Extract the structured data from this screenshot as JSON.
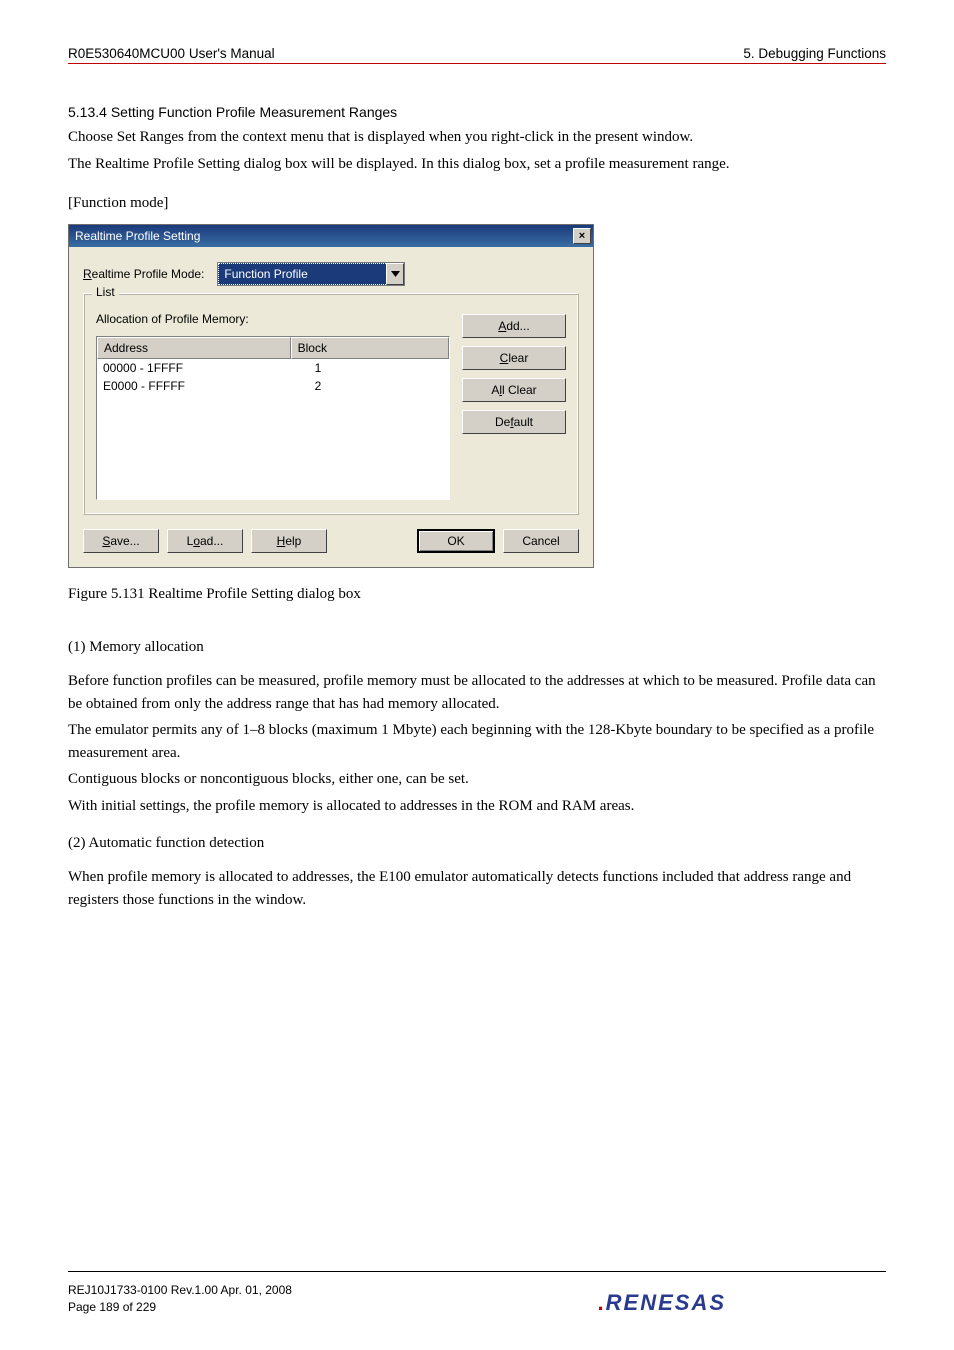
{
  "header": {
    "left": "R0E530640MCU00 User's Manual",
    "right": "5. Debugging Functions"
  },
  "section": {
    "heading": "5.13.4   Setting Function Profile Measurement Ranges",
    "intro1": "Choose Set Ranges from the context menu that is displayed when you right-click in the present window.",
    "intro2": "The Realtime Profile Setting dialog box will be displayed. In this dialog box, set a profile measurement range.",
    "mode_label": "[Function mode]"
  },
  "dialog": {
    "title": "Realtime Profile Setting",
    "close_glyph": "×",
    "mode_label_u": "R",
    "mode_label_rest": "ealtime Profile Mode:",
    "mode_value": "Function Profile",
    "list_legend": "List",
    "alloc_label": "Allocation of Profile Memory:",
    "table": {
      "headers": [
        "Address",
        "Block"
      ],
      "rows": [
        {
          "address": "00000 - 1FFFF",
          "block": "1"
        },
        {
          "address": "E0000 - FFFFF",
          "block": "2"
        }
      ]
    },
    "buttons": {
      "add_u": "A",
      "add_rest": "dd...",
      "clear_u": "C",
      "clear_rest": "lear",
      "allclear_pre": "A",
      "allclear_u": "l",
      "allclear_rest": "l Clear",
      "default_pre": "De",
      "default_u": "f",
      "default_rest": "ault"
    },
    "bottom": {
      "save_u": "S",
      "save_rest": "ave...",
      "load_pre": "L",
      "load_u": "o",
      "load_rest": "ad...",
      "help_u": "H",
      "help_rest": "elp",
      "ok": "OK",
      "cancel": "Cancel"
    }
  },
  "figure": {
    "caption": "Figure 5.131 Realtime Profile Setting dialog box"
  },
  "body": {
    "sub1": "(1) Memory allocation",
    "p1a": "Before function profiles can be measured, profile memory must be allocated to the addresses at which to be measured. Profile data can be obtained from only the address range that has had memory allocated.",
    "p1b": "The emulator permits any of 1–8 blocks (maximum 1 Mbyte) each beginning with the 128-Kbyte boundary to be specified as a profile measurement area.",
    "p1c": "Contiguous blocks or noncontiguous blocks, either one, can be set.",
    "p1d": "With initial settings, the profile memory is allocated to addresses in the ROM and RAM areas.",
    "sub2": "(2) Automatic function detection",
    "p2a": "When profile memory is allocated to addresses, the E100 emulator automatically detects functions included that address range and registers those functions in the window."
  },
  "footer": {
    "line1": "REJ10J1733-0100   Rev.1.00   Apr. 01, 2008",
    "line2": "Page 189 of 229",
    "logo": "RENESAS"
  }
}
